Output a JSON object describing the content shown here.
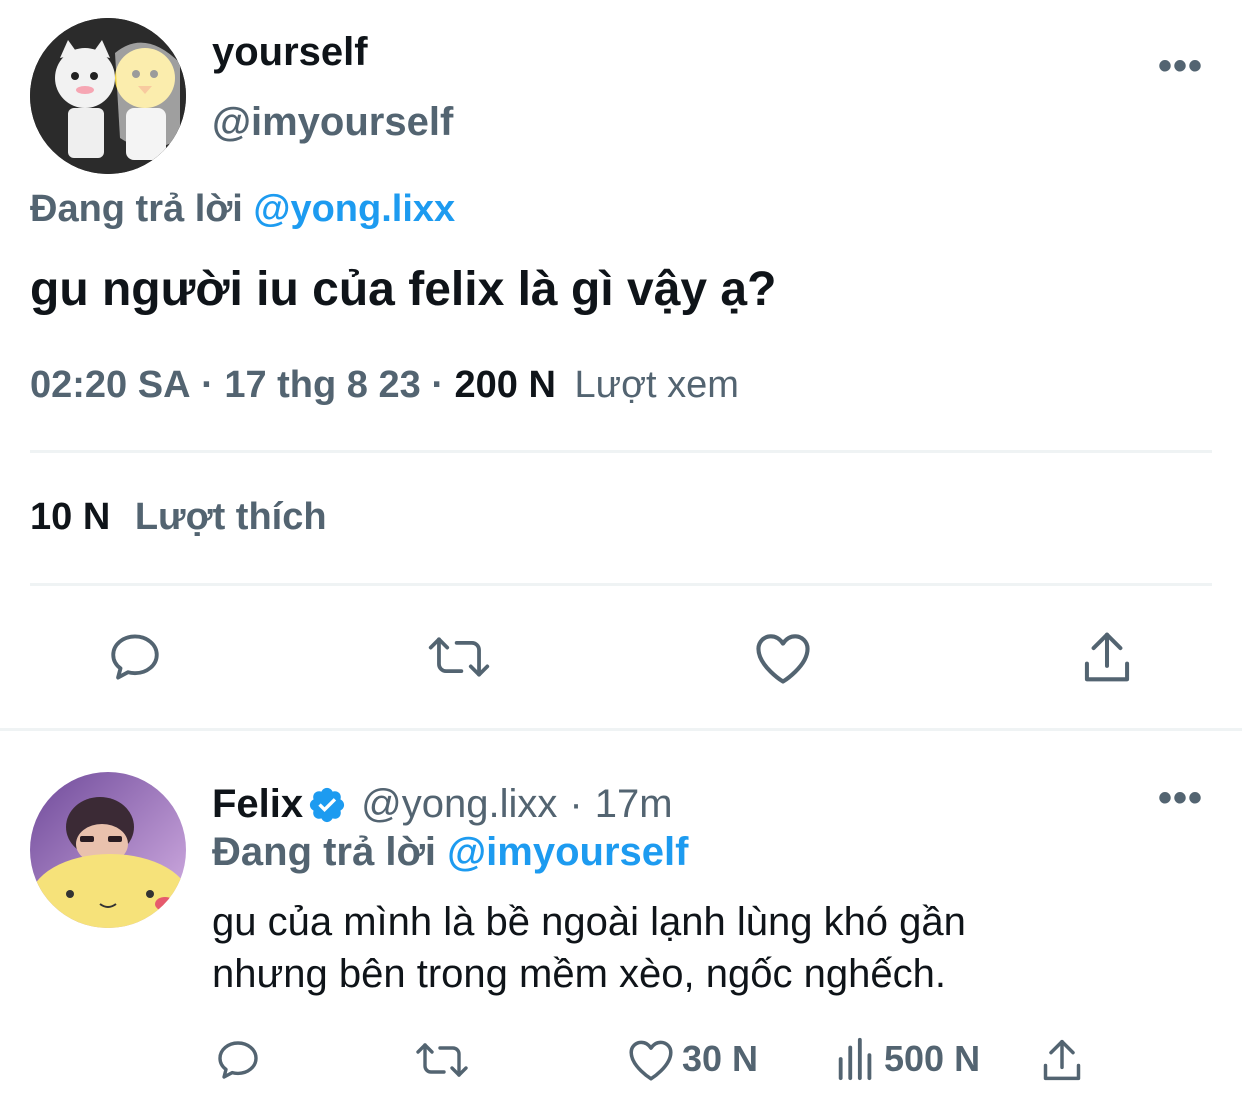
{
  "main_tweet": {
    "display_name": "yourself",
    "handle": "@imyourself",
    "reply_prefix": "Đang trả lời",
    "reply_to": "@yong.lixx",
    "text": "gu người iu của felix là gì vậy ạ?",
    "time": "02:20 SA",
    "separator": "·",
    "date": "17 thg 8 23",
    "views_count": "200 N",
    "views_label": "Lượt xem",
    "likes_count": "10 N",
    "likes_label": "Lượt thích",
    "more_label": "•••"
  },
  "reply_tweet": {
    "display_name": "Felix",
    "handle": "@yong.lixx",
    "separator": "·",
    "time_ago": "17m",
    "reply_prefix": "Đang trả lời",
    "reply_to": "@imyourself",
    "text": "gu của mình là bề ngoài lạnh lùng khó gần nhưng bên trong mềm xèo, ngốc nghếch.",
    "likes": "30 N",
    "views": "500 N",
    "more_label": "•••"
  },
  "colors": {
    "accent": "#1d9bf0",
    "muted": "#536471",
    "text": "#0f1419",
    "divider": "#eff3f4"
  },
  "icons": {
    "reply": "reply-icon",
    "retweet": "retweet-icon",
    "like": "heart-icon",
    "share": "share-icon",
    "views": "views-chart-icon",
    "verified": "verified-badge-icon"
  }
}
